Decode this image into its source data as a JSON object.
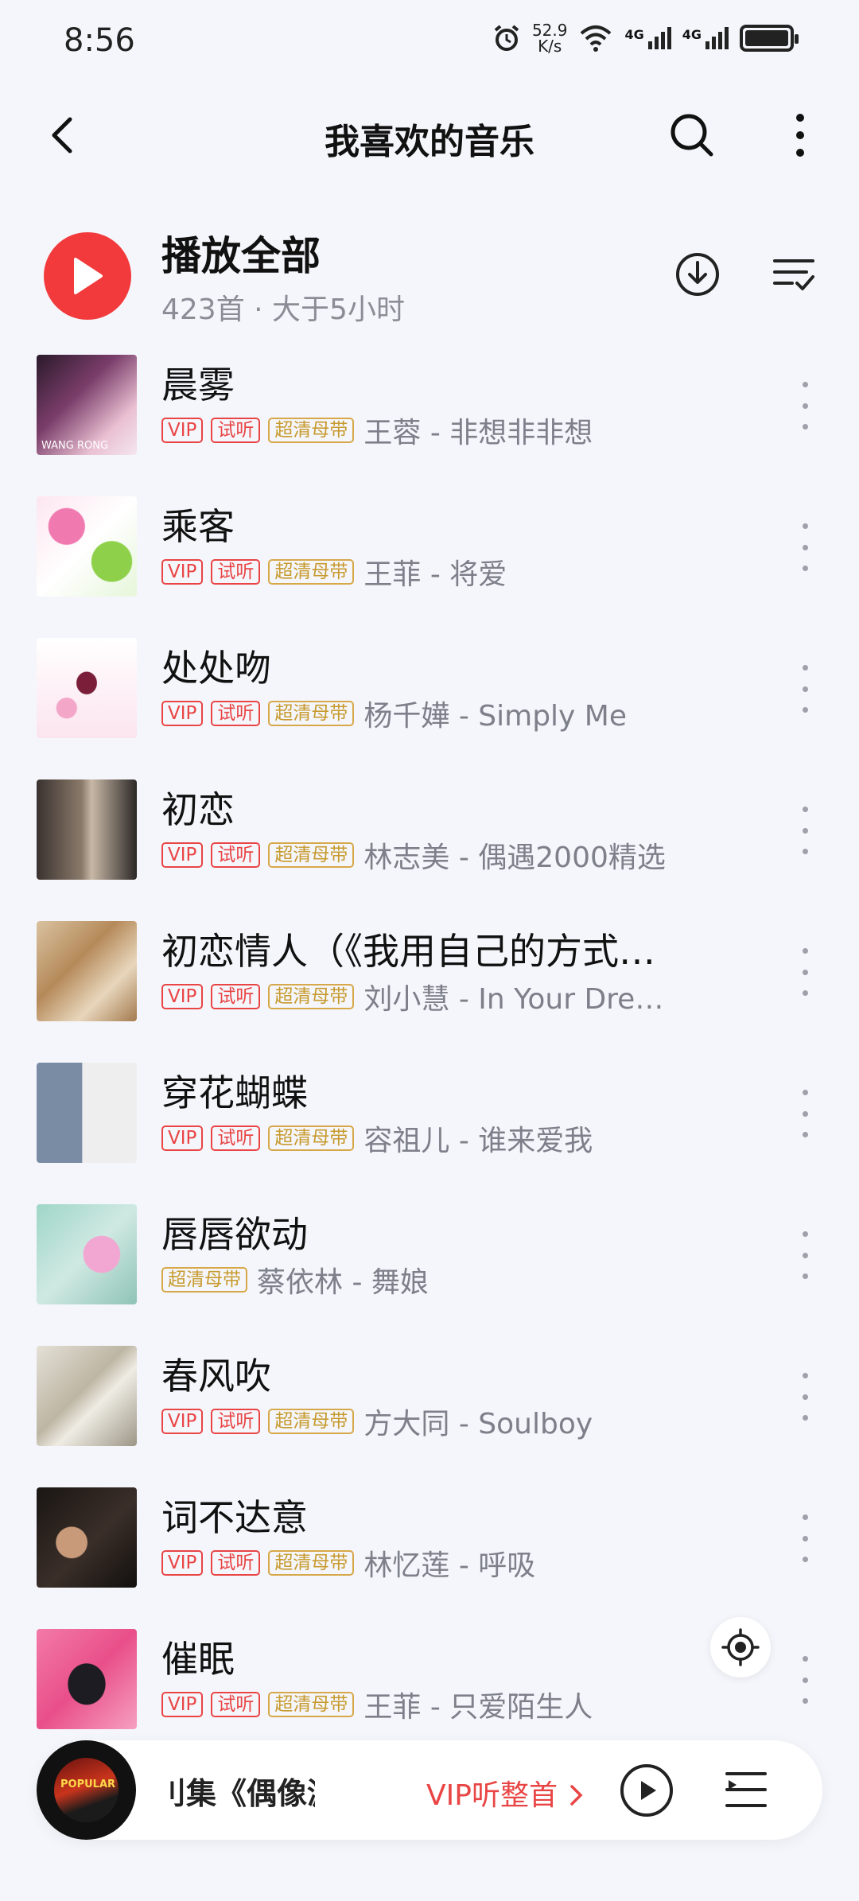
{
  "status": {
    "time": "8:56",
    "speed_value": "52.9",
    "speed_unit": "K/s",
    "net1": "4G",
    "net2": "4G"
  },
  "header": {
    "title": "我喜欢的音乐"
  },
  "playall": {
    "label": "播放全部",
    "meta": "423首 · 大于5小时"
  },
  "songs": [
    {
      "title": "晨雾",
      "tags": [
        "VIP",
        "试听",
        "超清母带"
      ],
      "artist": "王蓉 - 非想非非想",
      "cover_text": "WANG RONG"
    },
    {
      "title": "乘客",
      "tags": [
        "VIP",
        "试听",
        "超清母带"
      ],
      "artist": "王菲 - 将爱",
      "cover_text": ""
    },
    {
      "title": "处处吻",
      "tags": [
        "VIP",
        "试听",
        "超清母带"
      ],
      "artist": "杨千嬅 - Simply Me",
      "cover_text": ""
    },
    {
      "title": "初恋",
      "tags": [
        "VIP",
        "试听",
        "超清母带"
      ],
      "artist": "林志美 - 偶遇2000精选",
      "cover_text": ""
    },
    {
      "title": "初恋情人（《我用自己的方式…",
      "tags": [
        "VIP",
        "试听",
        "超清母带"
      ],
      "artist": "刘小慧 - In Your Dre…",
      "cover_text": ""
    },
    {
      "title": "穿花蝴蝶",
      "tags": [
        "VIP",
        "试听",
        "超清母带"
      ],
      "artist": "容祖儿 - 谁来爱我",
      "cover_text": ""
    },
    {
      "title": "唇唇欲动",
      "tags": [
        "超清母带"
      ],
      "artist": "蔡依林 - 舞娘",
      "cover_text": ""
    },
    {
      "title": "春风吹",
      "tags": [
        "VIP",
        "试听",
        "超清母带"
      ],
      "artist": "方大同 - Soulboy",
      "cover_text": ""
    },
    {
      "title": "词不达意",
      "tags": [
        "VIP",
        "试听",
        "超清母带"
      ],
      "artist": "林忆莲 - 呼吸",
      "cover_text": ""
    },
    {
      "title": "催眠",
      "tags": [
        "VIP",
        "试听",
        "超清母带"
      ],
      "artist": "王菲 - 只爱陌生人",
      "cover_text": ""
    }
  ],
  "player": {
    "now_playing": "刂集《偶像漩涡》肩",
    "vip_link": "VIP听整首",
    "disc_text": "POPULAR"
  },
  "colors": {
    "accent_red": "#f23a3c",
    "tag_red": "#e94545",
    "tag_gold": "#c79a2e",
    "background": "#f5f6fb"
  }
}
